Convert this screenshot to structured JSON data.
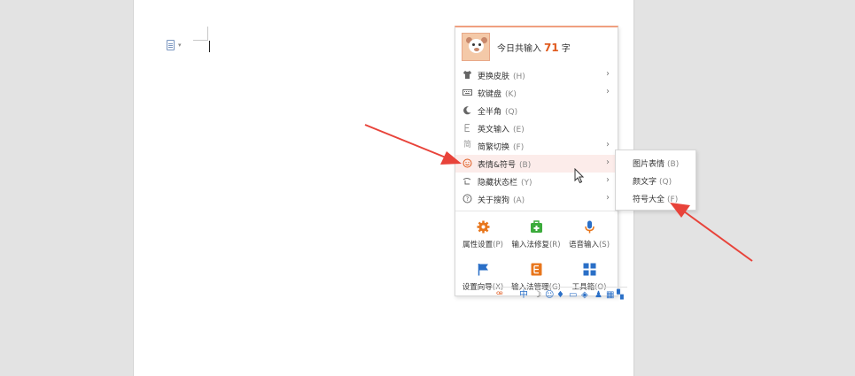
{
  "header": {
    "prefix": "今日共输入",
    "count": "71",
    "suffix": "字"
  },
  "menu_items": [
    {
      "label": "更换皮肤",
      "key": "(H)",
      "icon": "shirt-icon"
    },
    {
      "label": "软键盘",
      "key": "(K)",
      "icon": "keyboard-icon"
    },
    {
      "label": "全半角",
      "key": "(Q)",
      "icon": "moon-icon"
    },
    {
      "label": "英文输入",
      "key": "(E)",
      "icon": "english-icon"
    },
    {
      "label": "简繁切换",
      "key": "(F)",
      "icon": "simplified-traditional-icon"
    },
    {
      "label": "表情&符号",
      "key": "(B)",
      "icon": "smiley-icon"
    },
    {
      "label": "隐藏状态栏",
      "key": "(Y)",
      "icon": "hide-statusbar-icon"
    },
    {
      "label": "关于搜狗",
      "key": "(A)",
      "icon": "help-icon"
    }
  ],
  "tools": [
    {
      "label": "属性设置",
      "key": "(P)",
      "icon": "gear-icon",
      "color": "#e8761c"
    },
    {
      "label": "输入法修复",
      "key": "(R)",
      "icon": "repair-kit-icon",
      "color": "#3cab3c"
    },
    {
      "label": "语音输入",
      "key": "(S)",
      "icon": "microphone-icon",
      "color": "#2a6fc7"
    },
    {
      "label": "设置向导",
      "key": "(X)",
      "icon": "flag-icon",
      "color": "#2a6fc7"
    },
    {
      "label": "输入法管理",
      "key": "(G)",
      "icon": "manage-icon",
      "color": "#e8761c"
    },
    {
      "label": "工具箱",
      "key": "(O)",
      "icon": "toolbox-icon",
      "color": "#2a6fc7"
    }
  ],
  "submenu": [
    {
      "label": "图片表情",
      "key": "(B)"
    },
    {
      "label": "颜文字",
      "key": "(Q)"
    },
    {
      "label": "符号大全",
      "key": "(F)"
    }
  ],
  "colors": {
    "accent": "#e05a1e",
    "highlight": "#fcecea",
    "annotation_arrow": "#e8433a"
  }
}
